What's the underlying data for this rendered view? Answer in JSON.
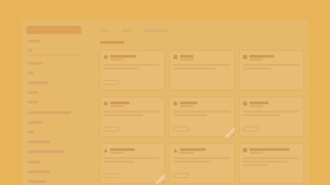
{
  "window": {
    "background": "#e8b457",
    "panel_background": "#e6b86a"
  },
  "sidebar": {
    "item_count": 17,
    "active_index": 0
  },
  "main": {
    "tabs": [
      "",
      "",
      ""
    ],
    "section_title": ""
  },
  "cards": [
    {
      "icon": "circle-icon",
      "title": "",
      "subtitle": "",
      "featured": false
    },
    {
      "icon": "square-icon",
      "title": "",
      "subtitle": "",
      "featured": false
    },
    {
      "icon": "square-icon",
      "title": "",
      "subtitle": "",
      "featured": false
    },
    {
      "icon": "circle-icon",
      "title": "",
      "subtitle": "",
      "featured": false
    },
    {
      "icon": "circle-icon",
      "title": "",
      "subtitle": "",
      "featured": true
    },
    {
      "icon": "square-icon",
      "title": "",
      "subtitle": "",
      "featured": false
    },
    {
      "icon": "triangle-icon",
      "title": "",
      "subtitle": "",
      "featured": true
    },
    {
      "icon": "triangle-icon",
      "title": "",
      "subtitle": "",
      "featured": false
    },
    {
      "icon": "square-icon",
      "title": "",
      "subtitle": "",
      "featured": false
    }
  ]
}
